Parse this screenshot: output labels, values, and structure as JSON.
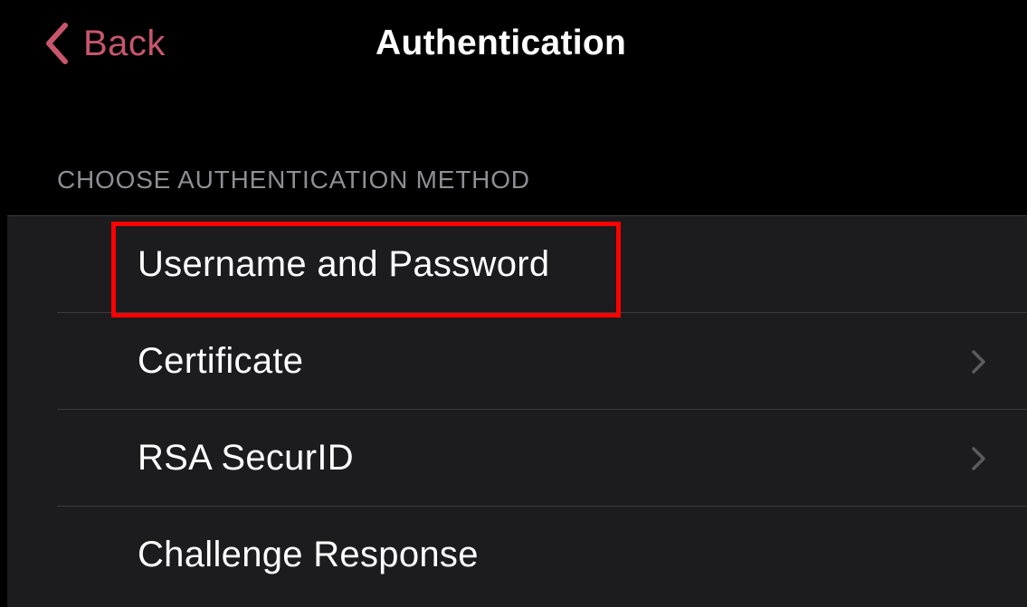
{
  "navbar": {
    "back_label": "Back",
    "back_icon": "chevron-left-icon",
    "title": "Authentication"
  },
  "section": {
    "header": "CHOOSE AUTHENTICATION METHOD"
  },
  "methods": [
    {
      "label": "Username and Password",
      "has_chevron": false,
      "highlighted": true
    },
    {
      "label": "Certificate",
      "has_chevron": true,
      "highlighted": false
    },
    {
      "label": "RSA SecurID",
      "has_chevron": true,
      "highlighted": false
    },
    {
      "label": "Challenge Response",
      "has_chevron": false,
      "highlighted": false
    }
  ],
  "colors": {
    "accent": "#c7566c",
    "background": "#000000",
    "list_background": "#1c1c1e",
    "separator": "#3a3a3c",
    "section_header": "#8e8e93",
    "highlight": "#ff0000"
  }
}
